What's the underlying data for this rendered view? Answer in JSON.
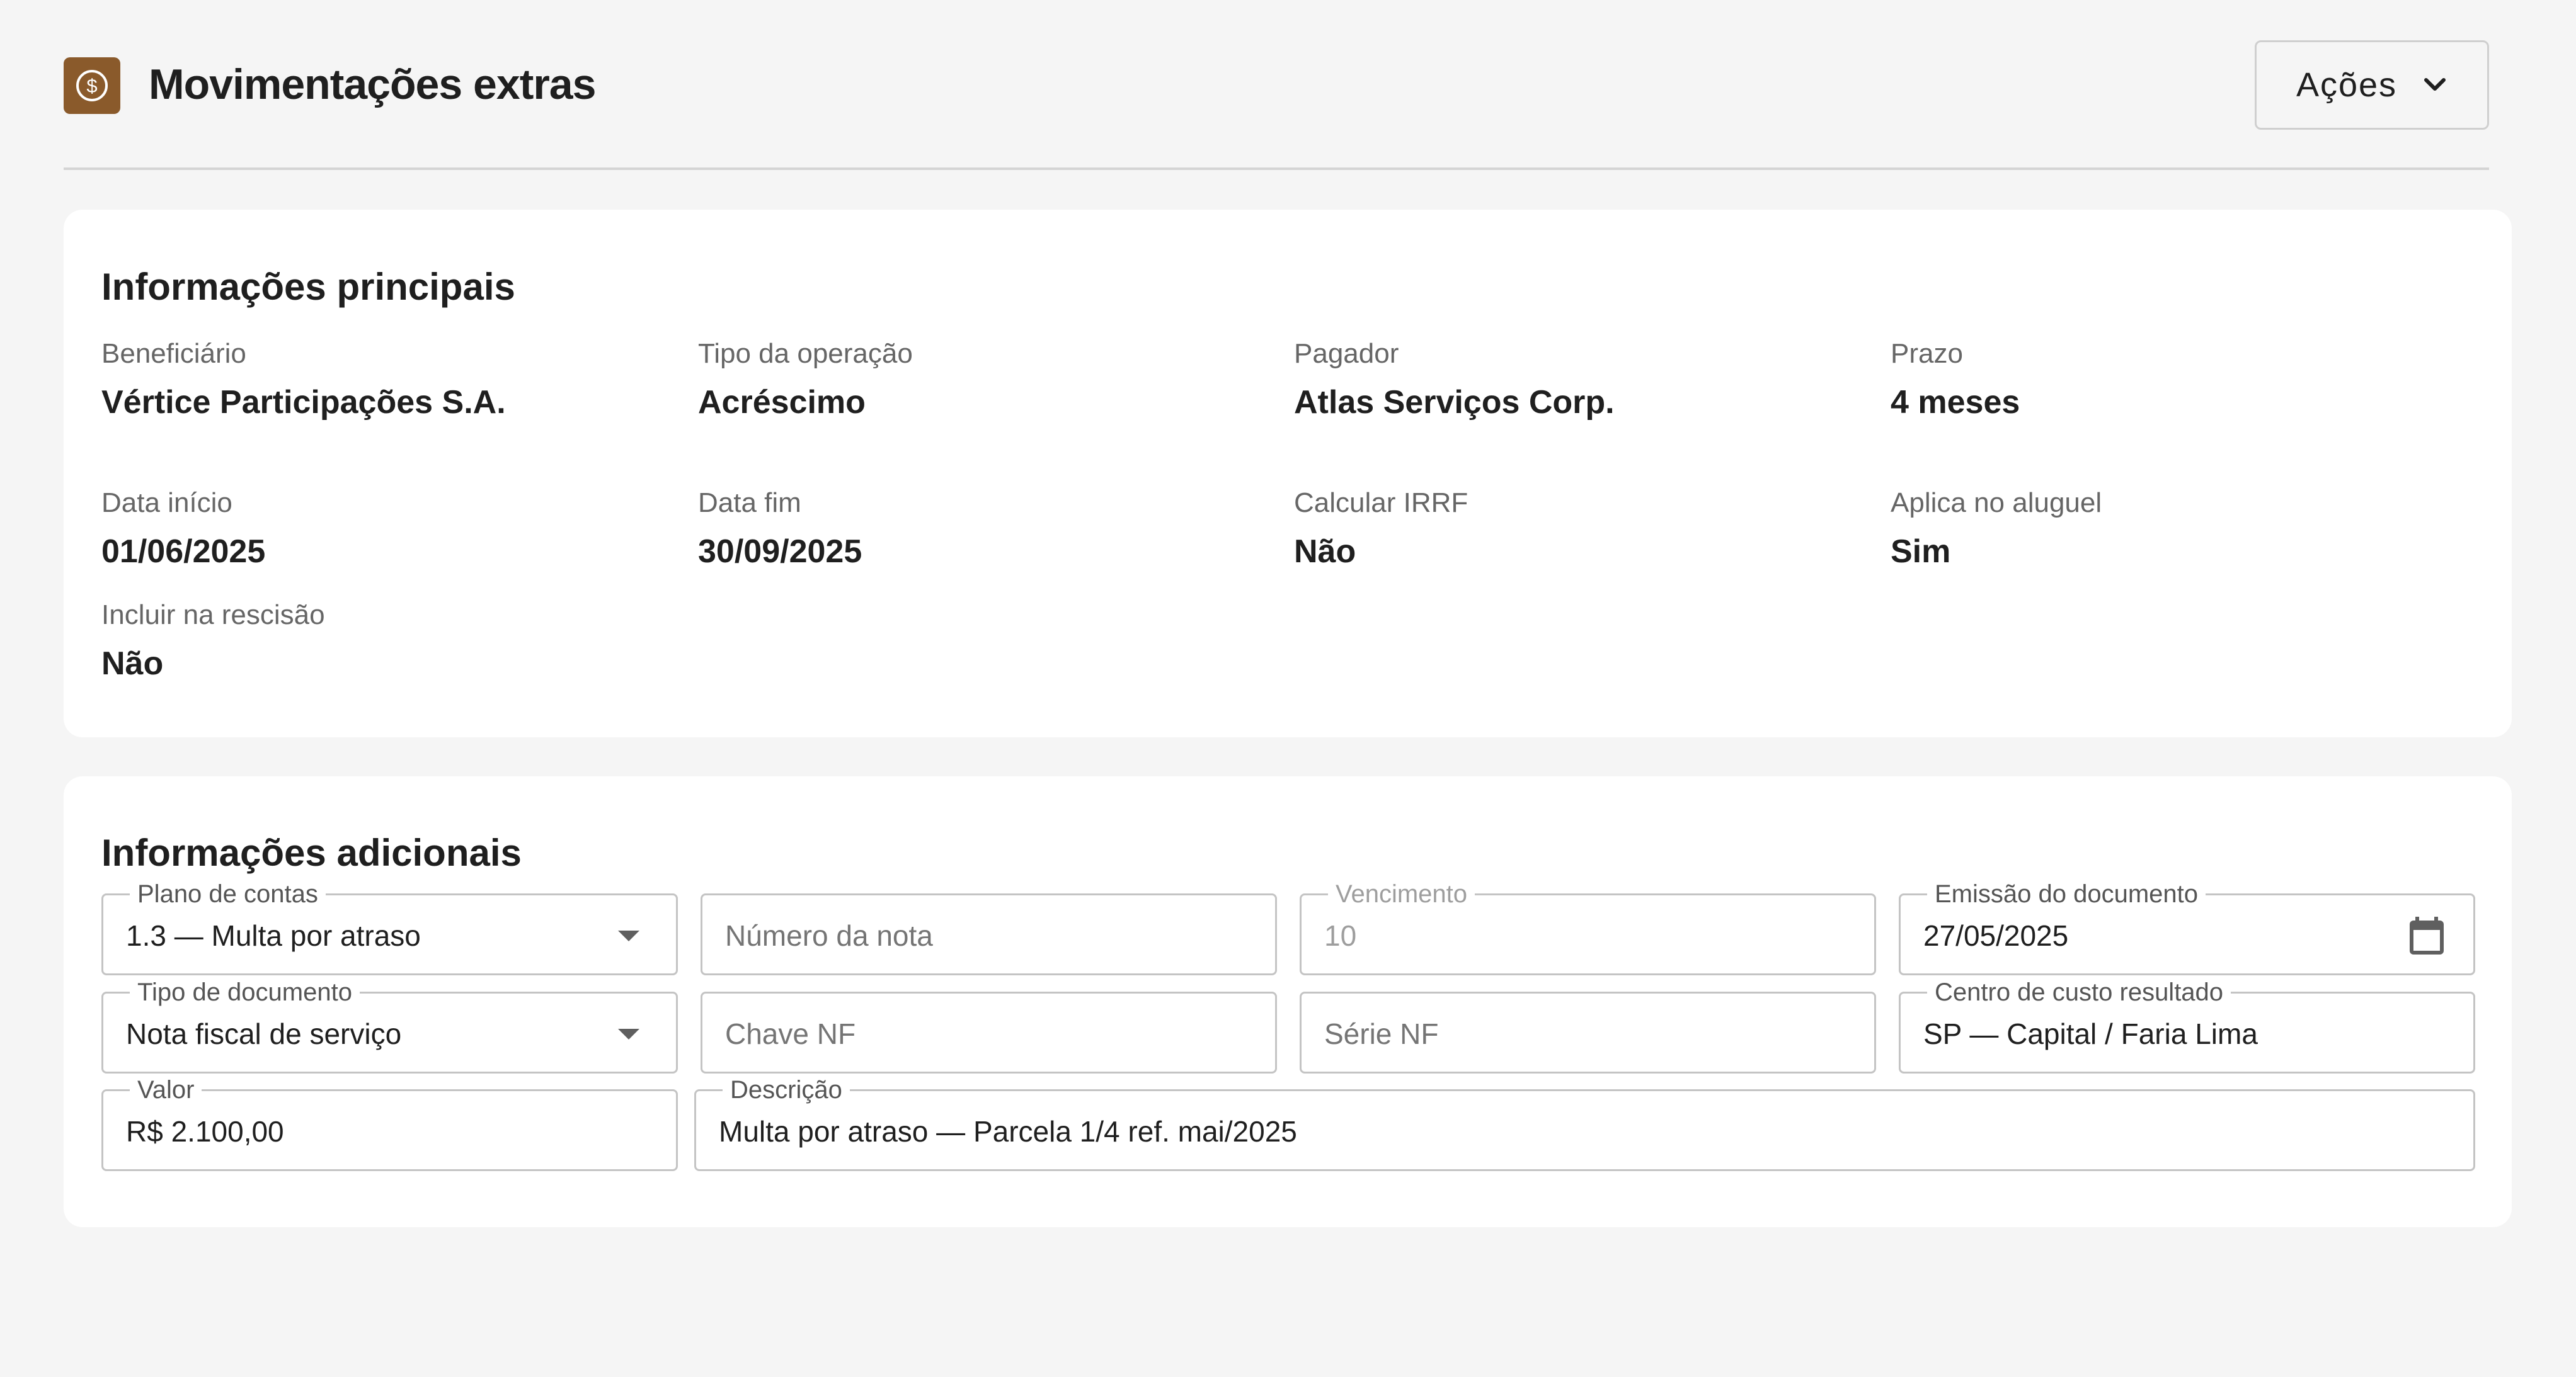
{
  "header": {
    "title": "Movimentações extras",
    "logo_icon": "dollar-circle-icon",
    "actions_label": "Ações"
  },
  "main_info": {
    "title": "Informações principais",
    "fields": [
      {
        "label": "Beneficiário",
        "value": "Vértice Participações S.A."
      },
      {
        "label": "Tipo da operação",
        "value": "Acréscimo"
      },
      {
        "label": "Pagador",
        "value": "Atlas Serviços Corp."
      },
      {
        "label": "Prazo",
        "value": "4 meses"
      },
      {
        "label": "Data início",
        "value": "01/06/2025"
      },
      {
        "label": "Data fim",
        "value": "30/09/2025"
      },
      {
        "label": "Calcular IRRF",
        "value": "Não"
      },
      {
        "label": "Aplica no aluguel",
        "value": "Sim"
      },
      {
        "label": "Incluir na rescisão",
        "value": "Não"
      }
    ]
  },
  "additional_info": {
    "title": "Informações adicionais",
    "plano_contas": {
      "label": "Plano de contas",
      "value": "1.3 — Multa por atraso"
    },
    "numero_nota": {
      "placeholder": "Número da nota"
    },
    "vencimento": {
      "label": "Vencimento",
      "value": "10"
    },
    "emissao": {
      "label": "Emissão do documento",
      "value": "27/05/2025"
    },
    "tipo_documento": {
      "label": "Tipo de documento",
      "value": "Nota fiscal de serviço"
    },
    "chave_nf": {
      "placeholder": "Chave NF"
    },
    "serie_nf": {
      "placeholder": "Série NF"
    },
    "centro_custo": {
      "label": "Centro de custo resultado",
      "value": "SP — Capital / Faria Lima"
    },
    "valor": {
      "label": "Valor",
      "value": "R$ 2.100,00"
    },
    "descricao": {
      "label": "Descrição",
      "value": "Multa por atraso — Parcela 1/4 ref. mai/2025"
    }
  },
  "colors": {
    "accent": "#8a5a2b",
    "background": "#f5f5f5",
    "card": "#ffffff"
  }
}
